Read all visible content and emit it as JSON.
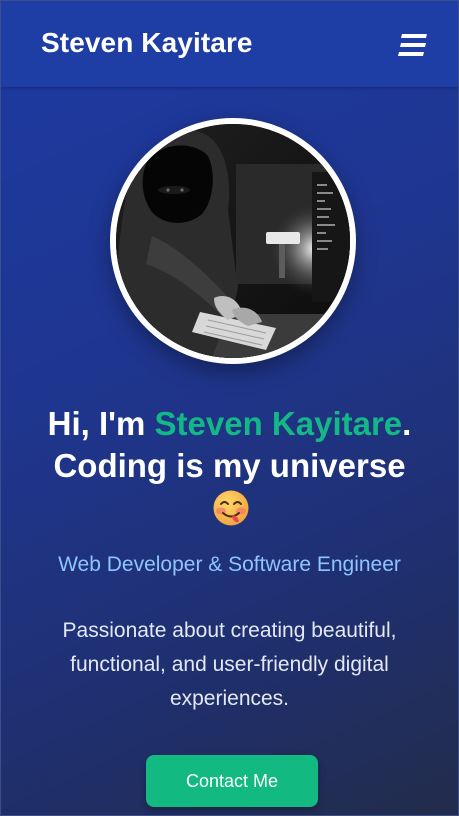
{
  "navbar": {
    "brand": "Steven Kayitare",
    "menu_icon": "hamburger-menu-icon"
  },
  "hero": {
    "avatar_icon": "hooded-coder-avatar",
    "greeting_prefix": "Hi, I'm ",
    "name": "Steven Kayitare",
    "greeting_suffix": ".",
    "tagline": "Coding is my universe",
    "emoji": "face-savoring-food-emoji",
    "subtitle": "Web Developer & Software Engineer",
    "description": "Passionate about creating beautiful, functional, and user-friendly digital experiences.",
    "cta_label": "Contact Me"
  },
  "colors": {
    "navbar_bg": "#1e3ea6",
    "accent_green": "#14b886",
    "subtitle_blue": "#8ec4ff",
    "button_green": "#12b981"
  }
}
